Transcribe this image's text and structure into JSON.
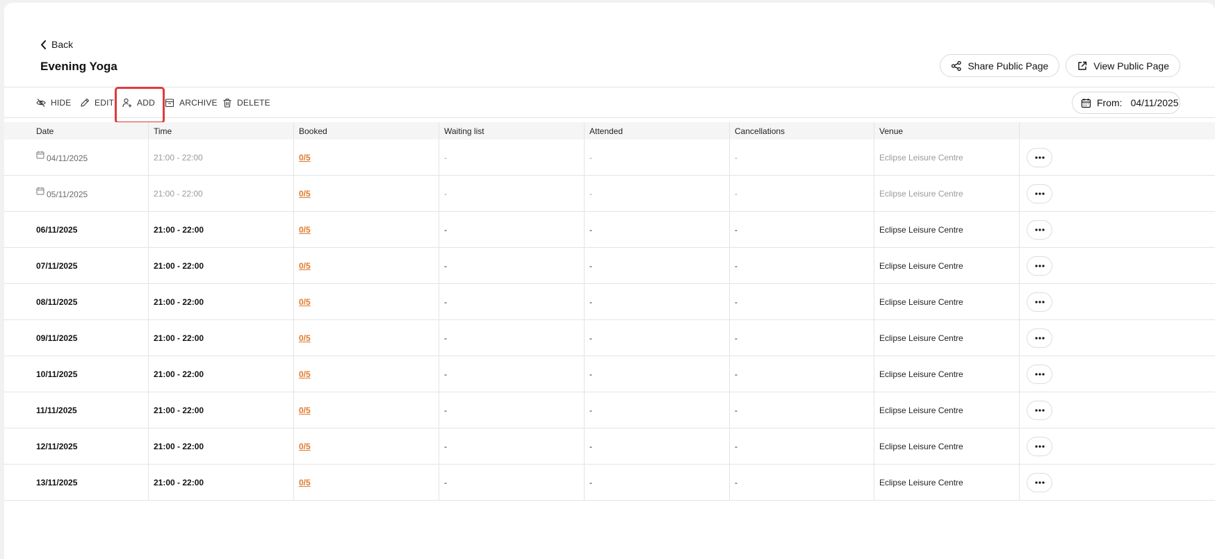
{
  "header": {
    "back_label": "Back",
    "title": "Evening Yoga",
    "share_label": "Share Public Page",
    "view_label": "View Public Page"
  },
  "toolbar": {
    "hide_label": "HIDE",
    "edit_label": "EDIT",
    "add_label": "ADD",
    "archive_label": "ARCHIVE",
    "delete_label": "DELETE",
    "from_label": "From:",
    "from_value": "04/11/2025"
  },
  "table": {
    "columns": [
      "Date",
      "Time",
      "Booked",
      "Waiting list",
      "Attended",
      "Cancellations",
      "Venue"
    ],
    "rows": [
      {
        "date": "04/11/2025",
        "time": "21:00 - 22:00",
        "booked": "0/5",
        "waiting": "-",
        "attended": "-",
        "cancellations": "-",
        "venue": "Eclipse Leisure Centre"
      },
      {
        "date": "05/11/2025",
        "time": "21:00 - 22:00",
        "booked": "0/5",
        "waiting": "-",
        "attended": "-",
        "cancellations": "-",
        "venue": "Eclipse Leisure Centre"
      },
      {
        "date": "06/11/2025",
        "time": "21:00 - 22:00",
        "booked": "0/5",
        "waiting": "-",
        "attended": "-",
        "cancellations": "-",
        "venue": "Eclipse Leisure Centre"
      },
      {
        "date": "07/11/2025",
        "time": "21:00 - 22:00",
        "booked": "0/5",
        "waiting": "-",
        "attended": "-",
        "cancellations": "-",
        "venue": "Eclipse Leisure Centre"
      },
      {
        "date": "08/11/2025",
        "time": "21:00 - 22:00",
        "booked": "0/5",
        "waiting": "-",
        "attended": "-",
        "cancellations": "-",
        "venue": "Eclipse Leisure Centre"
      },
      {
        "date": "09/11/2025",
        "time": "21:00 - 22:00",
        "booked": "0/5",
        "waiting": "-",
        "attended": "-",
        "cancellations": "-",
        "venue": "Eclipse Leisure Centre"
      },
      {
        "date": "10/11/2025",
        "time": "21:00 - 22:00",
        "booked": "0/5",
        "waiting": "-",
        "attended": "-",
        "cancellations": "-",
        "venue": "Eclipse Leisure Centre"
      },
      {
        "date": "11/11/2025",
        "time": "21:00 - 22:00",
        "booked": "0/5",
        "waiting": "-",
        "attended": "-",
        "cancellations": "-",
        "venue": "Eclipse Leisure Centre"
      },
      {
        "date": "12/11/2025",
        "time": "21:00 - 22:00",
        "booked": "0/5",
        "waiting": "-",
        "attended": "-",
        "cancellations": "-",
        "venue": "Eclipse Leisure Centre"
      },
      {
        "date": "13/11/2025",
        "time": "21:00 - 22:00",
        "booked": "0/5",
        "waiting": "-",
        "attended": "-",
        "cancellations": "-",
        "venue": "Eclipse Leisure Centre"
      }
    ]
  },
  "colors": {
    "accent_link": "#e2792b",
    "highlight_box": "#e0393e"
  },
  "icons": {
    "back": "chevron-left-icon",
    "share": "share-icon",
    "view": "external-link-icon",
    "hide": "eye-off-icon",
    "edit": "pencil-icon",
    "add": "user-plus-icon",
    "archive": "archive-box-icon",
    "delete": "trash-icon",
    "from": "calendar-icon",
    "more": "more-horizontal-icon"
  }
}
